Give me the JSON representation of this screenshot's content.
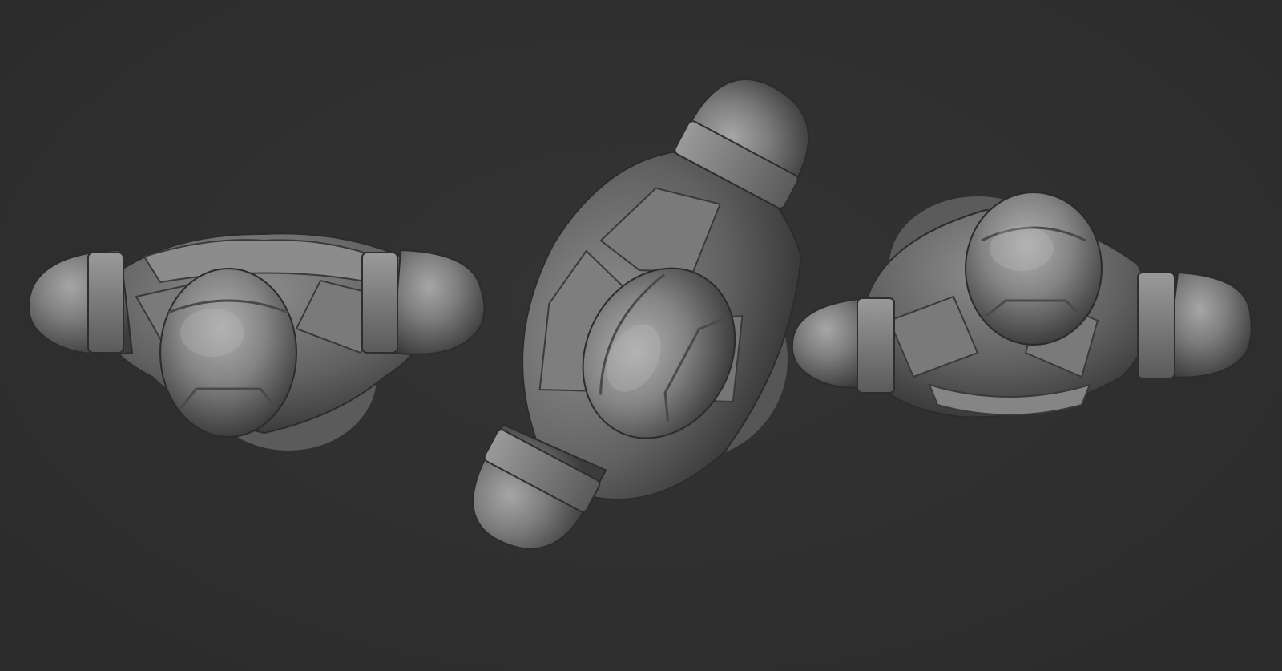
{
  "scene": {
    "background_color": "#2f2f2f",
    "material_color": "#8a8a8a",
    "views": [
      {
        "name": "torso-view-top-left",
        "rotation_deg": 0
      },
      {
        "name": "torso-view-diagonal",
        "rotation_deg": -62
      },
      {
        "name": "torso-view-top-right",
        "rotation_deg": 0
      }
    ]
  }
}
